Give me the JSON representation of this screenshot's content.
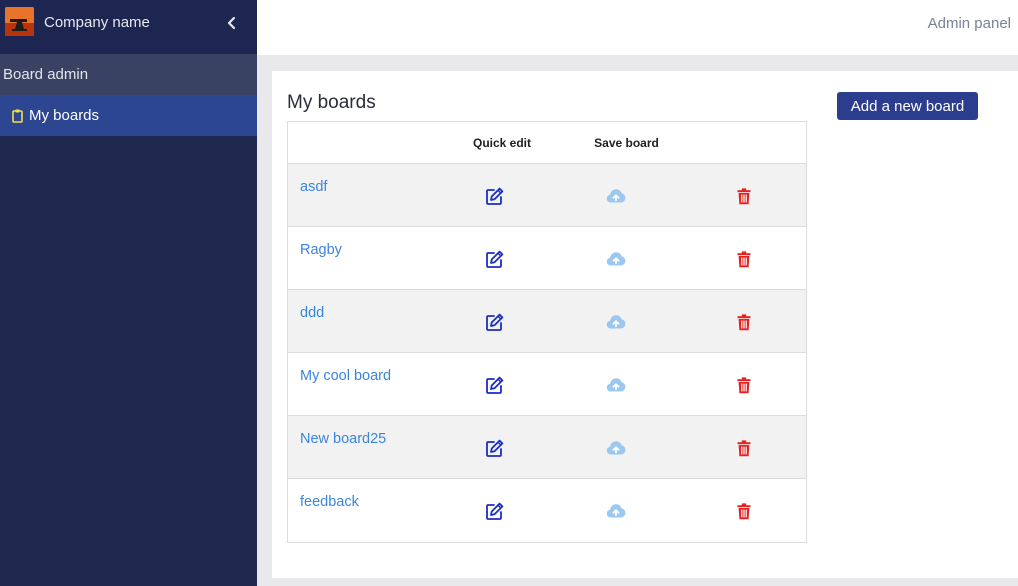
{
  "sidebar": {
    "brand_name": "Company name",
    "section_title": "Board admin",
    "items": [
      {
        "label": "My boards",
        "icon": "clipboard-icon",
        "active": true
      }
    ]
  },
  "header": {
    "right_label": "Admin panel"
  },
  "main": {
    "title": "My boards",
    "add_button_label": "Add a new board",
    "table": {
      "columns": [
        "",
        "Quick edit",
        "Save board",
        ""
      ],
      "rows": [
        {
          "name": "asdf"
        },
        {
          "name": "Ragby"
        },
        {
          "name": "ddd"
        },
        {
          "name": "My cool board"
        },
        {
          "name": "New board25"
        },
        {
          "name": "feedback"
        }
      ],
      "row_actions": [
        "edit-icon",
        "cloud-upload-icon",
        "trash-icon"
      ]
    }
  },
  "colors": {
    "sidebar_bg": "#1f294f",
    "active_item_bg": "#2d4691",
    "primary_button": "#2c3d8f",
    "link": "#3a85dc",
    "edit_icon": "#1a2fc2",
    "save_icon": "#9cc8ef",
    "delete_icon": "#e52222"
  }
}
